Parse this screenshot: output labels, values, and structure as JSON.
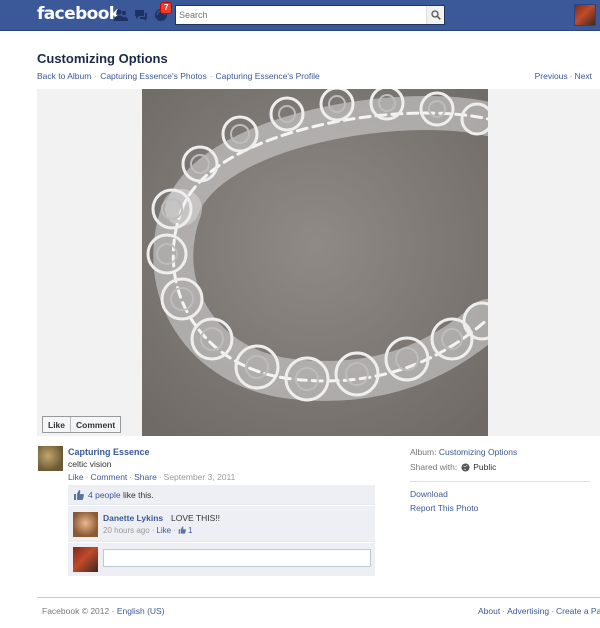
{
  "topbar": {
    "logo": "facebook",
    "notifications_count": "7",
    "search_placeholder": "Search"
  },
  "header": {
    "title": "Customizing Options",
    "breadcrumbs": [
      "Back to Album",
      "Capturing Essence's Photos",
      "Capturing Essence's Profile"
    ],
    "previous": "Previous",
    "next": "Next"
  },
  "photo_actions": {
    "like": "Like",
    "comment": "Comment"
  },
  "owner": {
    "name": "Capturing Essence",
    "caption": "celtic vision",
    "actions": [
      "Like",
      "Comment",
      "Share"
    ],
    "date": "September 3, 2011"
  },
  "ufi": {
    "likes_link": "4 people",
    "likes_text": "like this.",
    "comments": [
      {
        "author": "Danette Lykins",
        "text": "LOVE THIS!!",
        "time": "20 hours ago",
        "like": "Like",
        "like_count": "1"
      }
    ],
    "comment_placeholder": ""
  },
  "sidebar": {
    "album_label": "Album:",
    "album_name": "Customizing Options",
    "shared_label": "Shared with:",
    "shared_value": "Public",
    "download": "Download",
    "report": "Report This Photo"
  },
  "footer": {
    "copyright": "Facebook © 2012",
    "language": "English (US)",
    "links": [
      "About",
      "Advertising",
      "Create a Pa"
    ]
  }
}
